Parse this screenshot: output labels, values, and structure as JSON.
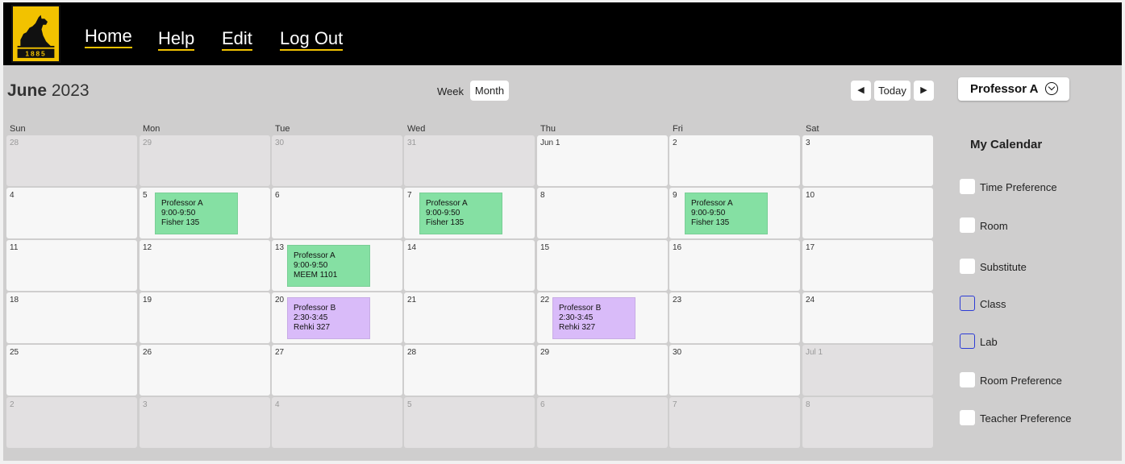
{
  "nav": {
    "logo_text": "1885",
    "links": [
      "Home",
      "Help",
      "Edit",
      "Log Out"
    ]
  },
  "header": {
    "month": "June",
    "year": "2023",
    "view_week": "Week",
    "view_month": "Month",
    "prev_icon": "◀",
    "today": "Today",
    "next_icon": "▶",
    "professor": "Professor A"
  },
  "days_of_week": [
    "Sun",
    "Mon",
    "Tue",
    "Wed",
    "Thu",
    "Fri",
    "Sat"
  ],
  "weeks": [
    [
      {
        "d": "28",
        "dim": true
      },
      {
        "d": "29",
        "dim": true
      },
      {
        "d": "30",
        "dim": true
      },
      {
        "d": "31",
        "dim": true
      },
      {
        "d": "Jun 1",
        "dim": false
      },
      {
        "d": "2",
        "dim": false
      },
      {
        "d": "3",
        "dim": false
      }
    ],
    [
      {
        "d": "4",
        "dim": false
      },
      {
        "d": "5",
        "dim": false
      },
      {
        "d": "6",
        "dim": false
      },
      {
        "d": "7",
        "dim": false
      },
      {
        "d": "8",
        "dim": false
      },
      {
        "d": "9",
        "dim": false
      },
      {
        "d": "10",
        "dim": false
      }
    ],
    [
      {
        "d": "11",
        "dim": false
      },
      {
        "d": "12",
        "dim": false
      },
      {
        "d": "13",
        "dim": false
      },
      {
        "d": "14",
        "dim": false
      },
      {
        "d": "15",
        "dim": false
      },
      {
        "d": "16",
        "dim": false
      },
      {
        "d": "17",
        "dim": false
      }
    ],
    [
      {
        "d": "18",
        "dim": false
      },
      {
        "d": "19",
        "dim": false
      },
      {
        "d": "20",
        "dim": false
      },
      {
        "d": "21",
        "dim": false
      },
      {
        "d": "22",
        "dim": false
      },
      {
        "d": "23",
        "dim": false
      },
      {
        "d": "24",
        "dim": false
      }
    ],
    [
      {
        "d": "25",
        "dim": false
      },
      {
        "d": "26",
        "dim": false
      },
      {
        "d": "27",
        "dim": false
      },
      {
        "d": "28",
        "dim": false
      },
      {
        "d": "29",
        "dim": false
      },
      {
        "d": "30",
        "dim": false
      },
      {
        "d": "Jul 1",
        "dim": true
      }
    ],
    [
      {
        "d": "2",
        "dim": true
      },
      {
        "d": "3",
        "dim": true
      },
      {
        "d": "4",
        "dim": true
      },
      {
        "d": "5",
        "dim": true
      },
      {
        "d": "6",
        "dim": true
      },
      {
        "d": "7",
        "dim": true
      },
      {
        "d": "8",
        "dim": true
      }
    ]
  ],
  "events": [
    {
      "date": "5",
      "who": "Professor A",
      "time": "9:00-9:50",
      "place": "Fisher 135",
      "color": "#85e0a3"
    },
    {
      "date": "7",
      "who": "Professor A",
      "time": "9:00-9:50",
      "place": "Fisher 135",
      "color": "#85e0a3"
    },
    {
      "date": "9",
      "who": "Professor A",
      "time": "9:00-9:50",
      "place": "Fisher 135",
      "color": "#85e0a3"
    },
    {
      "date": "13",
      "who": "Professor A",
      "time": "9:00-9:50",
      "place": "MEEM 1101",
      "color": "#85e0a3"
    },
    {
      "date": "20",
      "who": "Professor B",
      "time": "2:30-3:45",
      "place": "Rehki 327",
      "color": "#d9bbf9"
    },
    {
      "date": "22",
      "who": "Professor B",
      "time": "2:30-3:45",
      "place": "Rehki 327",
      "color": "#d9bbf9"
    }
  ],
  "sidebar": {
    "title": "My Calendar",
    "options": [
      {
        "label": "Time Preference",
        "style": "filled"
      },
      {
        "label": "Room",
        "style": "filled"
      },
      {
        "label": "Substitute",
        "style": "filled"
      },
      {
        "label": "Class",
        "style": "outline"
      },
      {
        "label": "Lab",
        "style": "outline"
      },
      {
        "label": "Room Preference",
        "style": "filled"
      },
      {
        "label": "Teacher Preference",
        "style": "filled"
      }
    ]
  }
}
